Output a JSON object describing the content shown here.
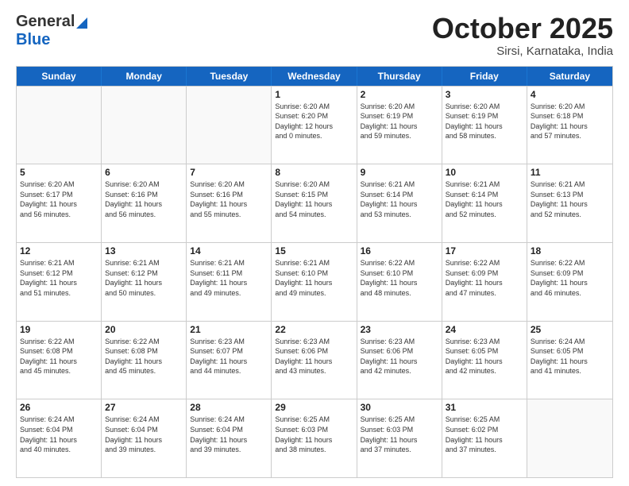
{
  "logo": {
    "general": "General",
    "blue": "Blue"
  },
  "title": {
    "month": "October 2025",
    "location": "Sirsi, Karnataka, India"
  },
  "header_days": [
    "Sunday",
    "Monday",
    "Tuesday",
    "Wednesday",
    "Thursday",
    "Friday",
    "Saturday"
  ],
  "rows": [
    [
      {
        "day": "",
        "info": ""
      },
      {
        "day": "",
        "info": ""
      },
      {
        "day": "",
        "info": ""
      },
      {
        "day": "1",
        "info": "Sunrise: 6:20 AM\nSunset: 6:20 PM\nDaylight: 12 hours\nand 0 minutes."
      },
      {
        "day": "2",
        "info": "Sunrise: 6:20 AM\nSunset: 6:19 PM\nDaylight: 11 hours\nand 59 minutes."
      },
      {
        "day": "3",
        "info": "Sunrise: 6:20 AM\nSunset: 6:19 PM\nDaylight: 11 hours\nand 58 minutes."
      },
      {
        "day": "4",
        "info": "Sunrise: 6:20 AM\nSunset: 6:18 PM\nDaylight: 11 hours\nand 57 minutes."
      }
    ],
    [
      {
        "day": "5",
        "info": "Sunrise: 6:20 AM\nSunset: 6:17 PM\nDaylight: 11 hours\nand 56 minutes."
      },
      {
        "day": "6",
        "info": "Sunrise: 6:20 AM\nSunset: 6:16 PM\nDaylight: 11 hours\nand 56 minutes."
      },
      {
        "day": "7",
        "info": "Sunrise: 6:20 AM\nSunset: 6:16 PM\nDaylight: 11 hours\nand 55 minutes."
      },
      {
        "day": "8",
        "info": "Sunrise: 6:20 AM\nSunset: 6:15 PM\nDaylight: 11 hours\nand 54 minutes."
      },
      {
        "day": "9",
        "info": "Sunrise: 6:21 AM\nSunset: 6:14 PM\nDaylight: 11 hours\nand 53 minutes."
      },
      {
        "day": "10",
        "info": "Sunrise: 6:21 AM\nSunset: 6:14 PM\nDaylight: 11 hours\nand 52 minutes."
      },
      {
        "day": "11",
        "info": "Sunrise: 6:21 AM\nSunset: 6:13 PM\nDaylight: 11 hours\nand 52 minutes."
      }
    ],
    [
      {
        "day": "12",
        "info": "Sunrise: 6:21 AM\nSunset: 6:12 PM\nDaylight: 11 hours\nand 51 minutes."
      },
      {
        "day": "13",
        "info": "Sunrise: 6:21 AM\nSunset: 6:12 PM\nDaylight: 11 hours\nand 50 minutes."
      },
      {
        "day": "14",
        "info": "Sunrise: 6:21 AM\nSunset: 6:11 PM\nDaylight: 11 hours\nand 49 minutes."
      },
      {
        "day": "15",
        "info": "Sunrise: 6:21 AM\nSunset: 6:10 PM\nDaylight: 11 hours\nand 49 minutes."
      },
      {
        "day": "16",
        "info": "Sunrise: 6:22 AM\nSunset: 6:10 PM\nDaylight: 11 hours\nand 48 minutes."
      },
      {
        "day": "17",
        "info": "Sunrise: 6:22 AM\nSunset: 6:09 PM\nDaylight: 11 hours\nand 47 minutes."
      },
      {
        "day": "18",
        "info": "Sunrise: 6:22 AM\nSunset: 6:09 PM\nDaylight: 11 hours\nand 46 minutes."
      }
    ],
    [
      {
        "day": "19",
        "info": "Sunrise: 6:22 AM\nSunset: 6:08 PM\nDaylight: 11 hours\nand 45 minutes."
      },
      {
        "day": "20",
        "info": "Sunrise: 6:22 AM\nSunset: 6:08 PM\nDaylight: 11 hours\nand 45 minutes."
      },
      {
        "day": "21",
        "info": "Sunrise: 6:23 AM\nSunset: 6:07 PM\nDaylight: 11 hours\nand 44 minutes."
      },
      {
        "day": "22",
        "info": "Sunrise: 6:23 AM\nSunset: 6:06 PM\nDaylight: 11 hours\nand 43 minutes."
      },
      {
        "day": "23",
        "info": "Sunrise: 6:23 AM\nSunset: 6:06 PM\nDaylight: 11 hours\nand 42 minutes."
      },
      {
        "day": "24",
        "info": "Sunrise: 6:23 AM\nSunset: 6:05 PM\nDaylight: 11 hours\nand 42 minutes."
      },
      {
        "day": "25",
        "info": "Sunrise: 6:24 AM\nSunset: 6:05 PM\nDaylight: 11 hours\nand 41 minutes."
      }
    ],
    [
      {
        "day": "26",
        "info": "Sunrise: 6:24 AM\nSunset: 6:04 PM\nDaylight: 11 hours\nand 40 minutes."
      },
      {
        "day": "27",
        "info": "Sunrise: 6:24 AM\nSunset: 6:04 PM\nDaylight: 11 hours\nand 39 minutes."
      },
      {
        "day": "28",
        "info": "Sunrise: 6:24 AM\nSunset: 6:04 PM\nDaylight: 11 hours\nand 39 minutes."
      },
      {
        "day": "29",
        "info": "Sunrise: 6:25 AM\nSunset: 6:03 PM\nDaylight: 11 hours\nand 38 minutes."
      },
      {
        "day": "30",
        "info": "Sunrise: 6:25 AM\nSunset: 6:03 PM\nDaylight: 11 hours\nand 37 minutes."
      },
      {
        "day": "31",
        "info": "Sunrise: 6:25 AM\nSunset: 6:02 PM\nDaylight: 11 hours\nand 37 minutes."
      },
      {
        "day": "",
        "info": ""
      }
    ]
  ]
}
